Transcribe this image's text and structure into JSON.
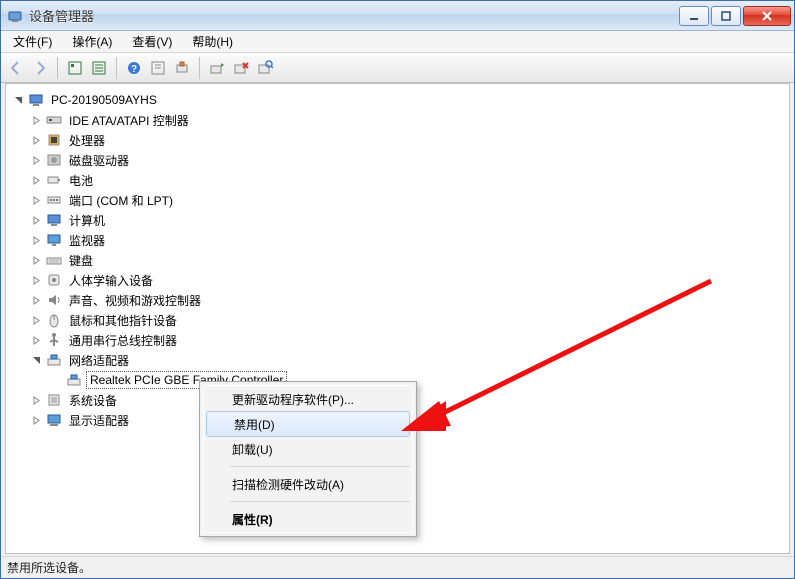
{
  "title": "设备管理器",
  "menus": {
    "file": "文件(F)",
    "action": "操作(A)",
    "view": "查看(V)",
    "help": "帮助(H)"
  },
  "status": "禁用所选设备。",
  "root": "PC-20190509AYHS",
  "categories": [
    {
      "label": "IDE ATA/ATAPI 控制器",
      "icon": "ide"
    },
    {
      "label": "处理器",
      "icon": "cpu"
    },
    {
      "label": "磁盘驱动器",
      "icon": "disk"
    },
    {
      "label": "电池",
      "icon": "battery"
    },
    {
      "label": "端口 (COM 和 LPT)",
      "icon": "port"
    },
    {
      "label": "计算机",
      "icon": "computer"
    },
    {
      "label": "监视器",
      "icon": "monitor"
    },
    {
      "label": "键盘",
      "icon": "keyboard"
    },
    {
      "label": "人体学输入设备",
      "icon": "hid"
    },
    {
      "label": "声音、视频和游戏控制器",
      "icon": "sound"
    },
    {
      "label": "鼠标和其他指针设备",
      "icon": "mouse"
    },
    {
      "label": "通用串行总线控制器",
      "icon": "usb"
    },
    {
      "label": "网络适配器",
      "icon": "network",
      "expanded": true,
      "child": "Realtek PCIe GBE Family Controller"
    },
    {
      "label": "系统设备",
      "icon": "system"
    },
    {
      "label": "显示适配器",
      "icon": "display"
    }
  ],
  "context": {
    "update": "更新驱动程序软件(P)...",
    "disable": "禁用(D)",
    "uninstall": "卸载(U)",
    "scan": "扫描检测硬件改动(A)",
    "properties": "属性(R)"
  }
}
